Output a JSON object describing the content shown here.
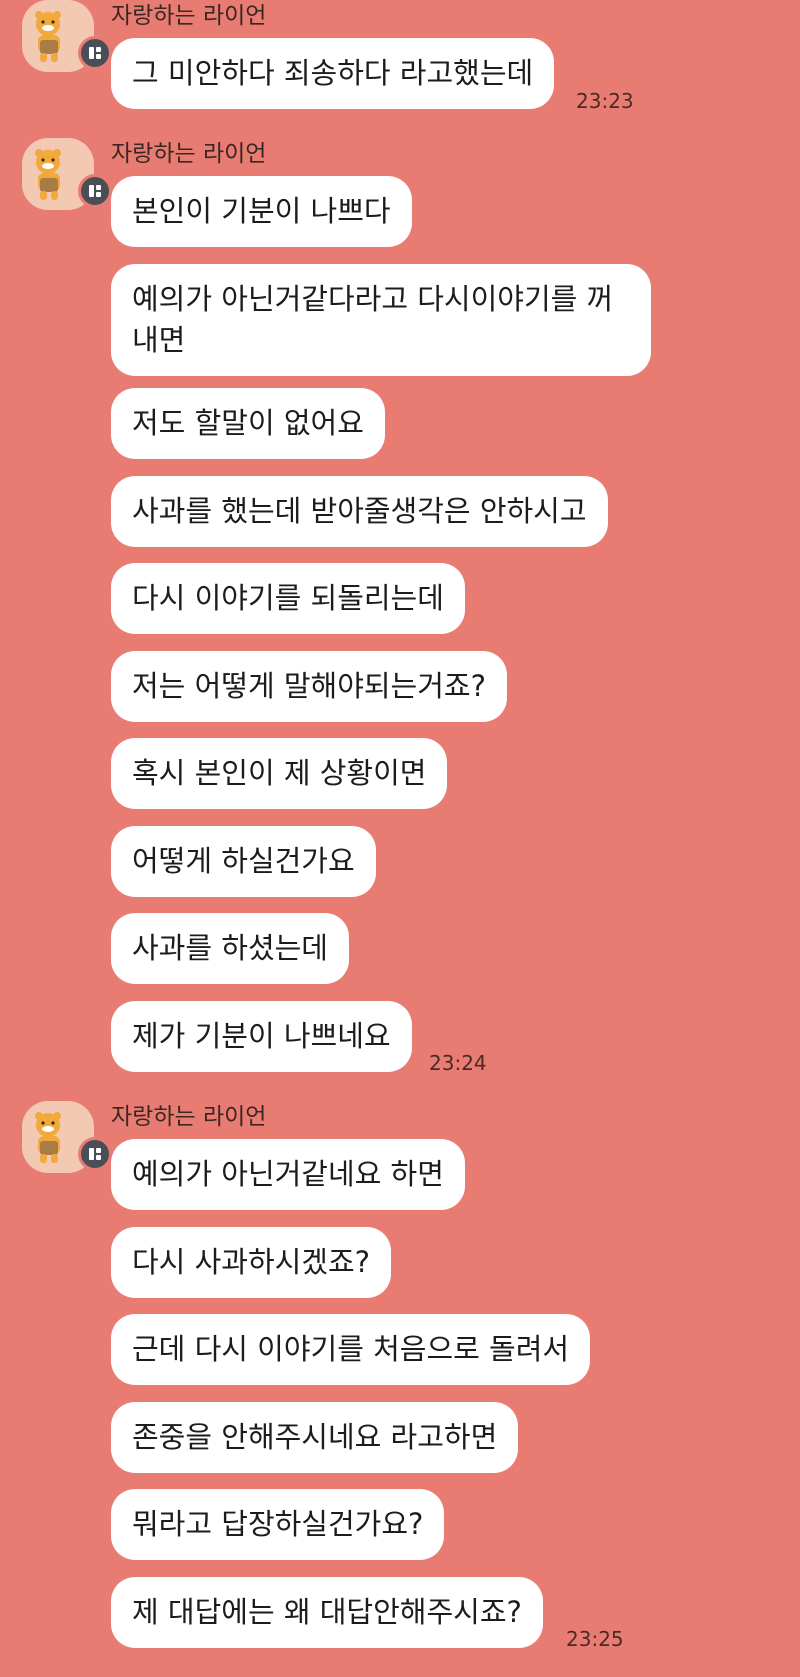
{
  "groups": [
    {
      "sender": "자랑하는 라이언",
      "messages": [
        "그 미안하다 죄송하다 라고했는데"
      ],
      "time": "23:23"
    },
    {
      "sender": "자랑하는 라이언",
      "messages": [
        "본인이 기분이 나쁘다",
        "예의가 아닌거같다라고 다시이야기를 꺼내면",
        "저도 할말이 없어요",
        "사과를 했는데 받아줄생각은 안하시고",
        "다시 이야기를 되돌리는데",
        "저는 어떻게 말해야되는거죠?",
        "혹시 본인이 제 상황이면",
        "어떻게 하실건가요",
        "사과를 하셨는데",
        "제가 기분이 나쁘네요"
      ],
      "time": "23:24"
    },
    {
      "sender": "자랑하는 라이언",
      "messages": [
        "예의가 아닌거같네요 하면",
        "다시 사과하시겠죠?",
        "근데 다시 이야기를 처음으로 돌려서",
        "존중을 안해주시네요 라고하면",
        "뭐라고 답장하실건가요?",
        "제 대답에는 왜 대답안해주시죠?"
      ],
      "time": "23:25"
    }
  ],
  "colors": {
    "background": "#e97c72",
    "bubble": "#ffffff",
    "avatar_bg": "#f3c9b3",
    "badge": "#4a4f57"
  },
  "icons": {
    "avatar": "ryan-lion-avatar-icon",
    "badge": "grid-badge-icon"
  }
}
